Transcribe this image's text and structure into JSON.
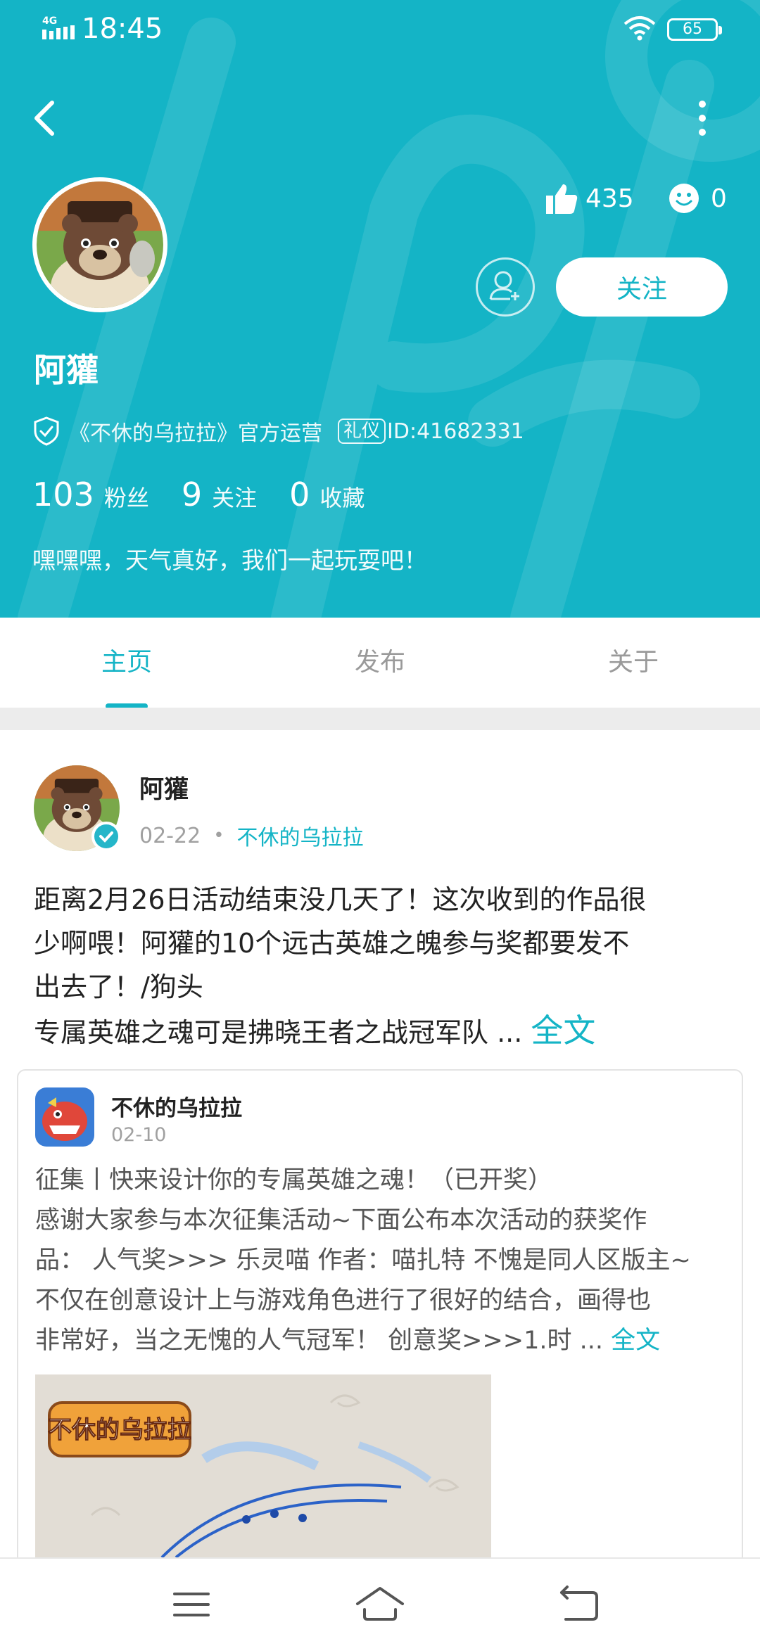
{
  "status_bar": {
    "network": "4G",
    "time": "18:45",
    "battery": "65"
  },
  "profile": {
    "name": "阿獾",
    "likes": "435",
    "emoji_count": "0",
    "follow_label": "关注",
    "verified_text": "《不休的乌拉拉》官方运营",
    "tag": "礼仪",
    "id_text": "ID:41682331",
    "counts": [
      {
        "num": "103",
        "label": "粉丝"
      },
      {
        "num": "9",
        "label": "关注"
      },
      {
        "num": "0",
        "label": "收藏"
      }
    ],
    "bio": "嘿嘿嘿，天气真好，我们一起玩耍吧！"
  },
  "tabs": [
    "主页",
    "发布",
    "关于"
  ],
  "post": {
    "author": "阿獾",
    "date": "02-22",
    "game": "不休的乌拉拉",
    "body_line1": "距离2月26日活动结束没几天了！这次收到的作品很",
    "body_line2": "少啊喂！阿獾的10个远古英雄之魄参与奖都要发不",
    "body_line3": "出去了！/狗头",
    "body_line4": "专属英雄之魂可是拂晓王者之战冠军队 ... ",
    "more_label": "全文"
  },
  "shared": {
    "title": "不休的乌拉拉",
    "date": "02-10",
    "line1": " 征集丨快来设计你的专属英雄之魂！（已开奖）",
    "line2": "感谢大家参与本次征集活动~下面公布本次活动的获奖作",
    "line3": "品： 人气奖>>> 乐灵喵 作者：喵扎特 不愧是同人区版主~",
    "line4": "不仅在创意设计上与游戏角色进行了很好的结合，画得也",
    "line5": "非常好，当之无愧的人气冠军！ 创意奖>>>1.时 ... ",
    "more_label": "全文",
    "image_logo_text": "不休的乌拉拉"
  },
  "colors": {
    "accent": "#14b4c6",
    "header_bg": "#14b4c6"
  },
  "icons": [
    "back-arrow-icon",
    "more-vert-icon",
    "thumbs-up-icon",
    "smiley-icon",
    "add-friend-icon",
    "verified-shield-icon",
    "menu-icon",
    "home-icon",
    "return-icon"
  ]
}
